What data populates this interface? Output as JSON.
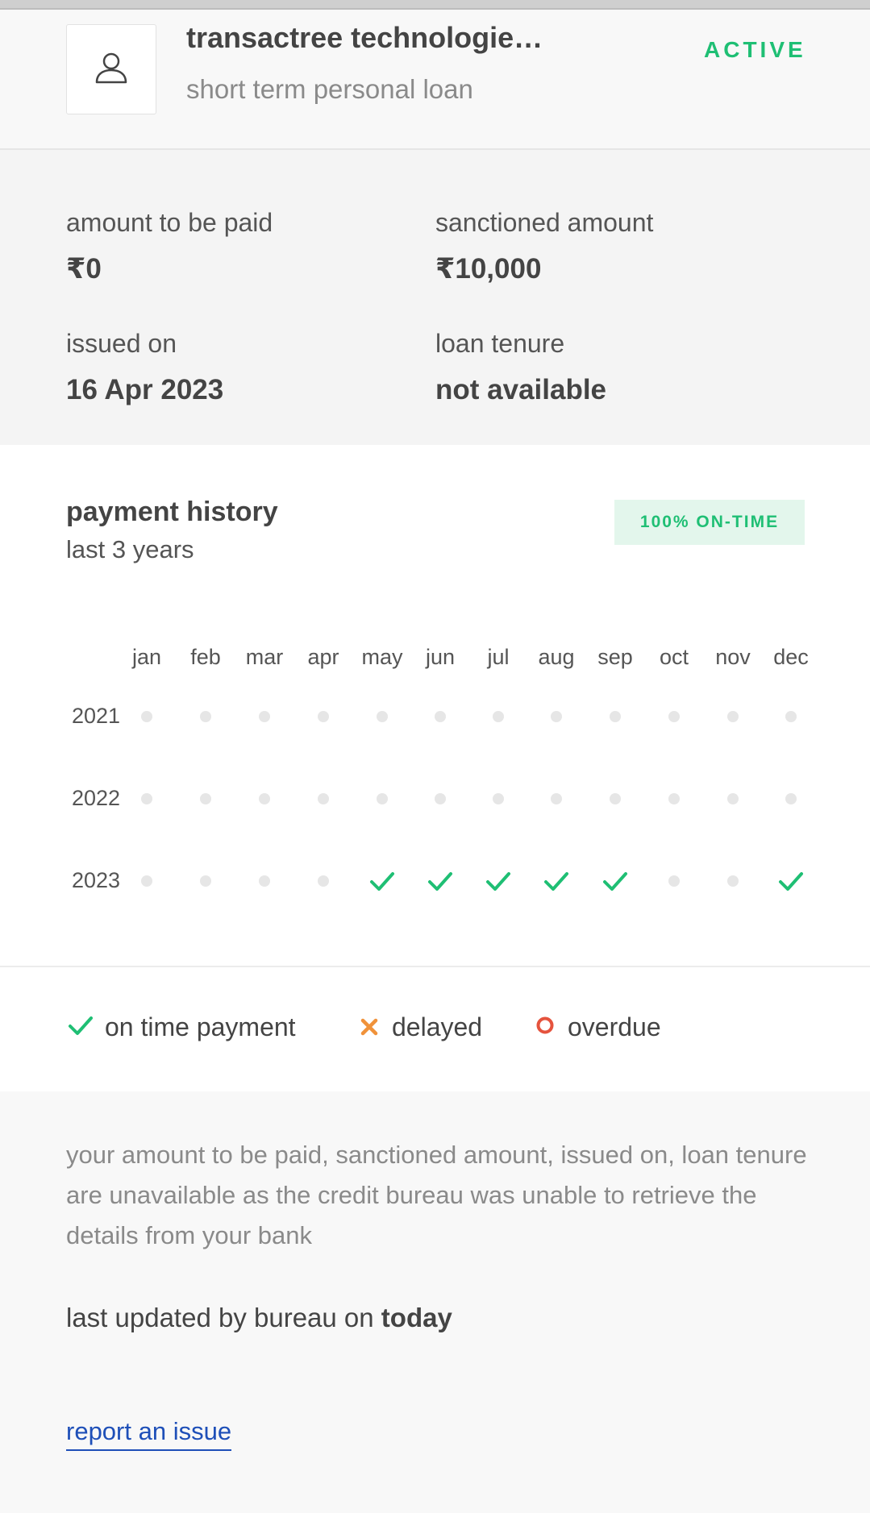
{
  "loan": {
    "lender_name": "transactree technologie…",
    "loan_type": "short term personal loan",
    "status": "ACTIVE",
    "avatar_icon": "user-icon"
  },
  "details": {
    "amount_to_be_paid_label": "amount to be paid",
    "amount_to_be_paid_value": "₹0",
    "sanctioned_amount_label": "sanctioned amount",
    "sanctioned_amount_value": "₹10,000",
    "issued_on_label": "issued on",
    "issued_on_value": "16 Apr 2023",
    "loan_tenure_label": "loan tenure",
    "loan_tenure_value": "not available"
  },
  "history": {
    "title": "payment history",
    "subtitle": "last 3 years",
    "badge": "100% ON-TIME",
    "months": [
      "jan",
      "feb",
      "mar",
      "apr",
      "may",
      "jun",
      "jul",
      "aug",
      "sep",
      "oct",
      "nov",
      "dec"
    ],
    "years": [
      {
        "year": "2021",
        "status": [
          "none",
          "none",
          "none",
          "none",
          "none",
          "none",
          "none",
          "none",
          "none",
          "none",
          "none",
          "none"
        ]
      },
      {
        "year": "2022",
        "status": [
          "none",
          "none",
          "none",
          "none",
          "none",
          "none",
          "none",
          "none",
          "none",
          "none",
          "none",
          "none"
        ]
      },
      {
        "year": "2023",
        "status": [
          "none",
          "none",
          "none",
          "none",
          "ontime",
          "ontime",
          "ontime",
          "ontime",
          "ontime",
          "none",
          "none",
          "ontime"
        ]
      }
    ]
  },
  "legend": {
    "on_time": "on time payment",
    "delayed": "delayed",
    "overdue": "overdue"
  },
  "colors": {
    "on_time": "#1fbf74",
    "delayed": "#f0923a",
    "overdue": "#e5533d",
    "link": "#1e4fb8"
  },
  "footer": {
    "note": "your amount to be paid, sanctioned amount, issued on, loan tenure are unavailable as the credit bureau was unable to retrieve the details from your bank",
    "updated_prefix": "last updated by bureau on ",
    "updated_value": "today",
    "report_link": "report an issue"
  }
}
